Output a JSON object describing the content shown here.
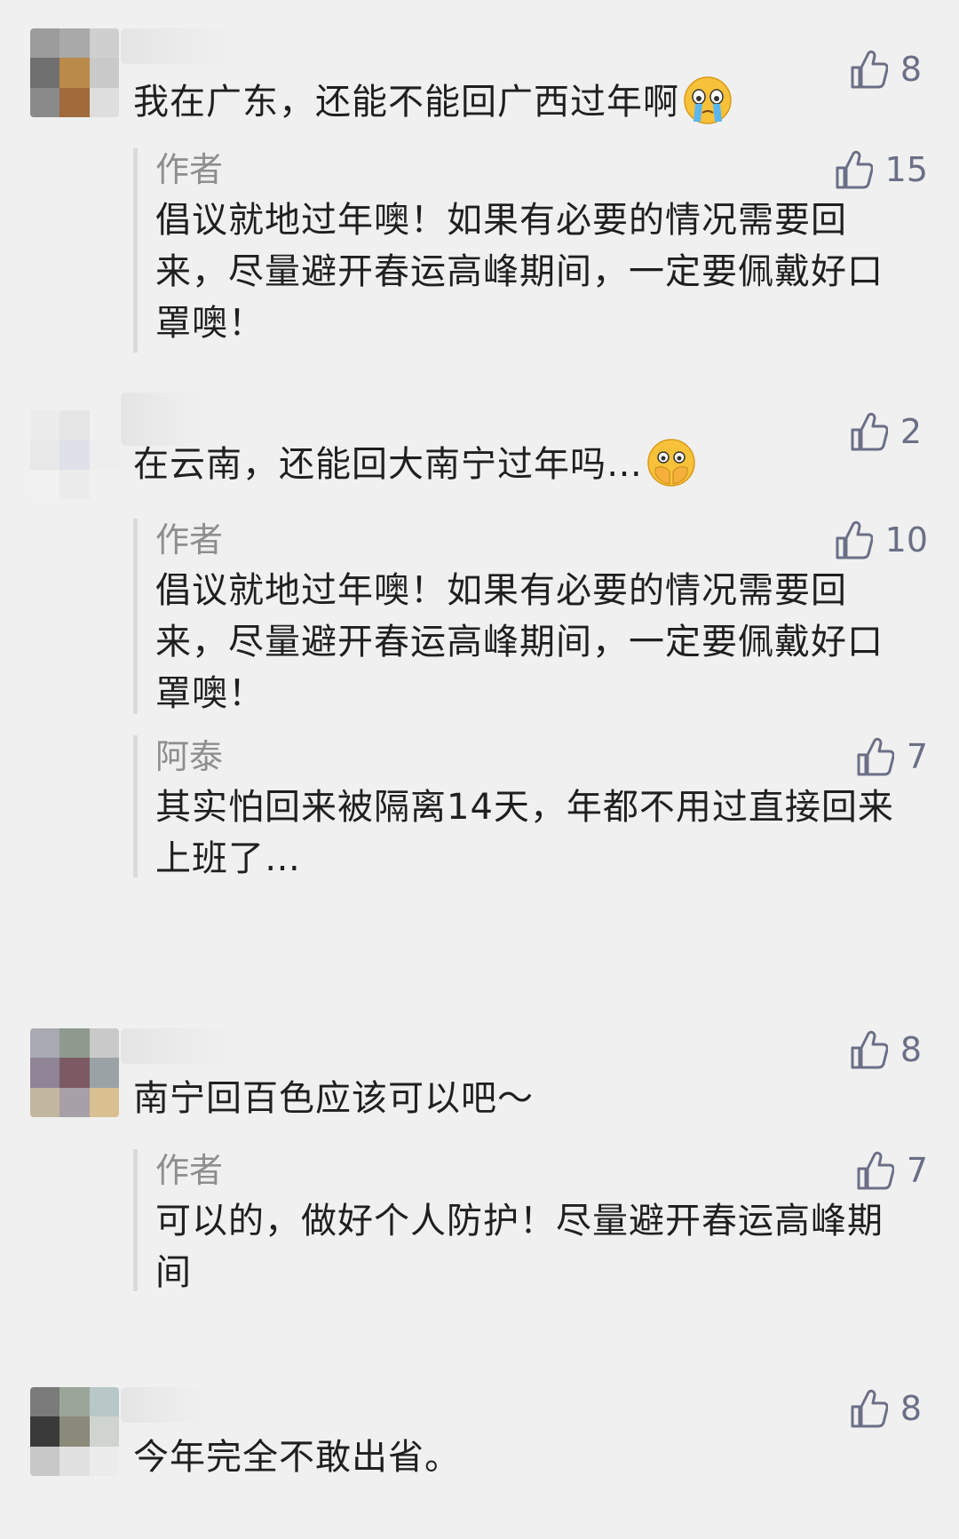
{
  "comments": [
    {
      "text": "我在广东，还能不能回广西过年啊",
      "emoji": "crying-face",
      "likes": "8",
      "avatar_colors": [
        "#9c9c9c",
        "#a9a9a9",
        "#cfcfcf",
        "#6f6f6f",
        "#b98a4a",
        "#c9c9c9",
        "#8a8a8a",
        "#a06a3a",
        "#dedede"
      ],
      "replies": [
        {
          "author": "作者",
          "likes": "15",
          "text": "倡议就地过年噢！如果有必要的情况需要回来，尽量避开春运高峰期间，一定要佩戴好口罩噢！"
        }
      ]
    },
    {
      "text": "在云南，还能回大南宁过年吗…",
      "emoji": "hands-over-face",
      "likes": "2",
      "avatar_colors": [
        "#ececec",
        "#e6e6e6",
        "#f0f0f0",
        "#e8e8e8",
        "#dfe1ea",
        "#eeeeee",
        "#f1f1f1",
        "#ebebeb",
        "#f0f0f0"
      ],
      "replies": [
        {
          "author": "作者",
          "likes": "10",
          "text": "倡议就地过年噢！如果有必要的情况需要回来，尽量避开春运高峰期间，一定要佩戴好口罩噢！"
        },
        {
          "author": "阿泰",
          "likes": "7",
          "text": "其实怕回来被隔离14天，年都不用过直接回来上班了…"
        }
      ]
    },
    {
      "text": "南宁回百色应该可以吧～",
      "emoji": "",
      "likes": "8",
      "avatar_colors": [
        "#a9a9b4",
        "#8e9a8e",
        "#c9c9c9",
        "#8e8496",
        "#7c5a64",
        "#9aa2a6",
        "#c2b6a0",
        "#a8a0a8",
        "#d8c090"
      ],
      "replies": [
        {
          "author": "作者",
          "likes": "7",
          "text": "可以的，做好个人防护！尽量避开春运高峰期间"
        }
      ]
    },
    {
      "text": "今年完全不敢出省。",
      "emoji": "",
      "likes": "8",
      "avatar_colors": [
        "#7a7a7a",
        "#9aa69a",
        "#b8c8c8",
        "#3a3a3a",
        "#8a8a7a",
        "#d0d4d0",
        "#c8c8c8",
        "#e0e0e0",
        "#ececec"
      ],
      "replies": []
    }
  ]
}
